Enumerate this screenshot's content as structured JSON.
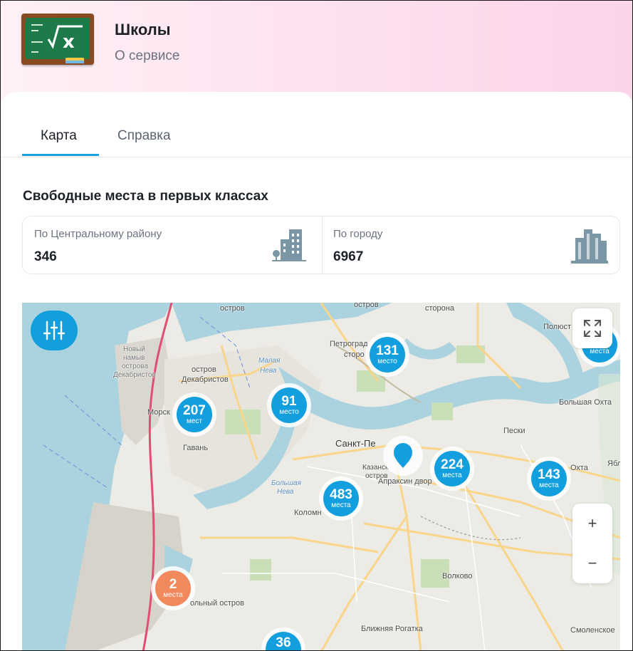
{
  "header": {
    "title": "Школы",
    "subtitle": "О сервисе",
    "icon": "chalkboard-math-icon"
  },
  "tabs": [
    {
      "label": "Карта",
      "active": true
    },
    {
      "label": "Справка",
      "active": false
    }
  ],
  "section": {
    "title": "Свободные места в первых классах"
  },
  "stats": [
    {
      "label": "По Центральному району",
      "value": "346",
      "icon": "district-buildings-icon"
    },
    {
      "label": "По городу",
      "value": "6967",
      "icon": "city-buildings-icon"
    }
  ],
  "map": {
    "labels": {
      "ostrov_top": "остров",
      "ostrov_top2": "остров",
      "storona": "сторона",
      "novy_nomy": "Новый",
      "novy_nomy2": "намыв",
      "novy_nomy3": "острова",
      "novy_nomy4": "Декабристов",
      "ostrov_dekab1": "остров",
      "ostrov_dekab2": "Декабристов",
      "malaya_neva1": "Малая",
      "malaya_neva2": "Нева",
      "petrograd1": "Петроград",
      "petrograd2": "сторо",
      "morsk": "Морск",
      "gavan": "Гавань",
      "spb": "Санкт-Пе",
      "kazan1": "Казанск",
      "kazan2": "остров",
      "apraksin": "Апраксин двор",
      "bolshaya_neva1": "Большая",
      "bolshaya_neva2": "Нева",
      "kolomna": "Коломн",
      "peski": "Пески",
      "okhta": "Охта",
      "bolshaya_okhta": "Большая Охта",
      "polyust": "Полюст",
      "yabl": "Ябл",
      "volkovo": "Волково",
      "blizh_rogatka": "Ближняя Рогатка",
      "smolenskoe": "Смоленское",
      "gutuev": "ольный остров"
    },
    "clusters": [
      {
        "count": "131",
        "unit": "место",
        "color": "blue"
      },
      {
        "count": "91",
        "unit": "место",
        "color": "blue"
      },
      {
        "count": "207",
        "unit": "мест",
        "color": "blue"
      },
      {
        "count": "483",
        "unit": "места",
        "color": "blue"
      },
      {
        "count": "224",
        "unit": "места",
        "color": "blue"
      },
      {
        "count": "143",
        "unit": "места",
        "color": "blue"
      },
      {
        "count": "2",
        "unit": "места",
        "color": "orange"
      },
      {
        "count": "36",
        "unit": "",
        "color": "blue"
      },
      {
        "count": "",
        "unit": "места",
        "color": "blue"
      }
    ],
    "controls": {
      "filter_icon": "sliders-icon",
      "fullscreen_icon": "expand-icon",
      "zoom_in": "+",
      "zoom_out": "−"
    },
    "colors": {
      "cluster_blue": "#139fde",
      "cluster_orange": "#f2895c",
      "water": "#aad3df",
      "accent": "#1aa2de"
    }
  }
}
